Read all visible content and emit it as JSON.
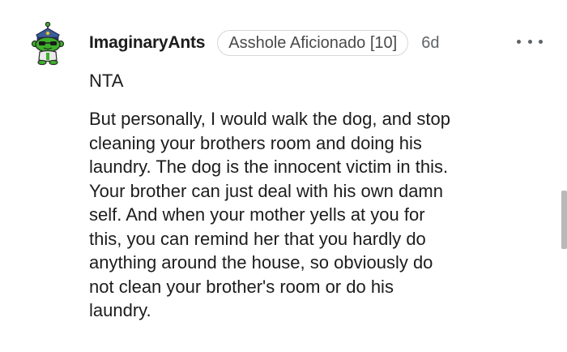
{
  "comment": {
    "avatar_icon": "snoo-police-avatar-icon",
    "username": "ImaginaryAnts",
    "flair": "Asshole Aficionado [10]",
    "age": "6d",
    "more_icon": "more-options-icon",
    "verdict": "NTA",
    "body_lines": [
      "But personally, I would walk the dog, and stop",
      "cleaning your brothers room and doing his",
      "laundry. The dog is the innocent victim in this.",
      "Your brother can just deal with his own damn",
      "self. And when your mother yells at you for",
      "this, you can remind her that you hardly do",
      "anything around the house, so obviously do",
      "not clean your brother's room or do his",
      "laundry."
    ]
  },
  "colors": {
    "avatar_body": "#3db02b",
    "avatar_hat": "#3a5d9c",
    "flair_border": "#d7d7d7",
    "meta_text": "#5f6366",
    "text": "#1c1c1c"
  }
}
